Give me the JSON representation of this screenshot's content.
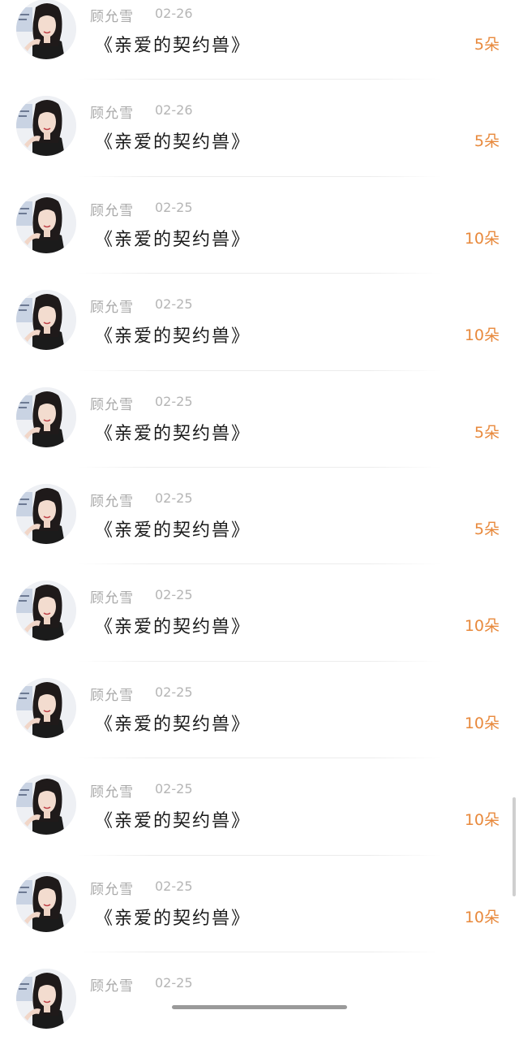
{
  "records": [
    {
      "author": "顾允雪",
      "date": "02-26",
      "book": "《亲爱的契约兽》",
      "amount": "5朵"
    },
    {
      "author": "顾允雪",
      "date": "02-26",
      "book": "《亲爱的契约兽》",
      "amount": "5朵"
    },
    {
      "author": "顾允雪",
      "date": "02-25",
      "book": "《亲爱的契约兽》",
      "amount": "10朵"
    },
    {
      "author": "顾允雪",
      "date": "02-25",
      "book": "《亲爱的契约兽》",
      "amount": "10朵"
    },
    {
      "author": "顾允雪",
      "date": "02-25",
      "book": "《亲爱的契约兽》",
      "amount": "5朵"
    },
    {
      "author": "顾允雪",
      "date": "02-25",
      "book": "《亲爱的契约兽》",
      "amount": "5朵"
    },
    {
      "author": "顾允雪",
      "date": "02-25",
      "book": "《亲爱的契约兽》",
      "amount": "10朵"
    },
    {
      "author": "顾允雪",
      "date": "02-25",
      "book": "《亲爱的契约兽》",
      "amount": "10朵"
    },
    {
      "author": "顾允雪",
      "date": "02-25",
      "book": "《亲爱的契约兽》",
      "amount": "10朵"
    },
    {
      "author": "顾允雪",
      "date": "02-25",
      "book": "《亲爱的契约兽》",
      "amount": "10朵"
    },
    {
      "author": "顾允雪",
      "date": "02-25",
      "book": "",
      "amount": ""
    }
  ],
  "colors": {
    "amount": "#e8893c",
    "meta": "#a9a9a9",
    "title": "#1a1a1a"
  },
  "icons": {
    "avatar": "user-avatar-photo"
  }
}
